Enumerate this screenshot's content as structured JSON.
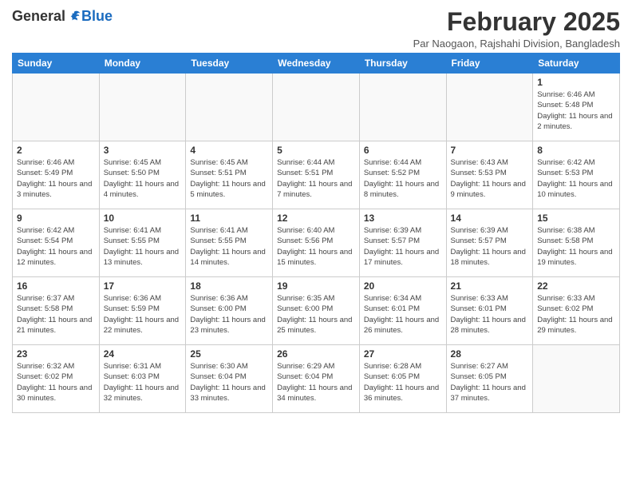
{
  "header": {
    "logo_general": "General",
    "logo_blue": "Blue",
    "month_title": "February 2025",
    "subtitle": "Par Naogaon, Rajshahi Division, Bangladesh"
  },
  "weekdays": [
    "Sunday",
    "Monday",
    "Tuesday",
    "Wednesday",
    "Thursday",
    "Friday",
    "Saturday"
  ],
  "weeks": [
    [
      {
        "day": "",
        "info": ""
      },
      {
        "day": "",
        "info": ""
      },
      {
        "day": "",
        "info": ""
      },
      {
        "day": "",
        "info": ""
      },
      {
        "day": "",
        "info": ""
      },
      {
        "day": "",
        "info": ""
      },
      {
        "day": "1",
        "info": "Sunrise: 6:46 AM\nSunset: 5:48 PM\nDaylight: 11 hours and 2 minutes."
      }
    ],
    [
      {
        "day": "2",
        "info": "Sunrise: 6:46 AM\nSunset: 5:49 PM\nDaylight: 11 hours and 3 minutes."
      },
      {
        "day": "3",
        "info": "Sunrise: 6:45 AM\nSunset: 5:50 PM\nDaylight: 11 hours and 4 minutes."
      },
      {
        "day": "4",
        "info": "Sunrise: 6:45 AM\nSunset: 5:51 PM\nDaylight: 11 hours and 5 minutes."
      },
      {
        "day": "5",
        "info": "Sunrise: 6:44 AM\nSunset: 5:51 PM\nDaylight: 11 hours and 7 minutes."
      },
      {
        "day": "6",
        "info": "Sunrise: 6:44 AM\nSunset: 5:52 PM\nDaylight: 11 hours and 8 minutes."
      },
      {
        "day": "7",
        "info": "Sunrise: 6:43 AM\nSunset: 5:53 PM\nDaylight: 11 hours and 9 minutes."
      },
      {
        "day": "8",
        "info": "Sunrise: 6:42 AM\nSunset: 5:53 PM\nDaylight: 11 hours and 10 minutes."
      }
    ],
    [
      {
        "day": "9",
        "info": "Sunrise: 6:42 AM\nSunset: 5:54 PM\nDaylight: 11 hours and 12 minutes."
      },
      {
        "day": "10",
        "info": "Sunrise: 6:41 AM\nSunset: 5:55 PM\nDaylight: 11 hours and 13 minutes."
      },
      {
        "day": "11",
        "info": "Sunrise: 6:41 AM\nSunset: 5:55 PM\nDaylight: 11 hours and 14 minutes."
      },
      {
        "day": "12",
        "info": "Sunrise: 6:40 AM\nSunset: 5:56 PM\nDaylight: 11 hours and 15 minutes."
      },
      {
        "day": "13",
        "info": "Sunrise: 6:39 AM\nSunset: 5:57 PM\nDaylight: 11 hours and 17 minutes."
      },
      {
        "day": "14",
        "info": "Sunrise: 6:39 AM\nSunset: 5:57 PM\nDaylight: 11 hours and 18 minutes."
      },
      {
        "day": "15",
        "info": "Sunrise: 6:38 AM\nSunset: 5:58 PM\nDaylight: 11 hours and 19 minutes."
      }
    ],
    [
      {
        "day": "16",
        "info": "Sunrise: 6:37 AM\nSunset: 5:58 PM\nDaylight: 11 hours and 21 minutes."
      },
      {
        "day": "17",
        "info": "Sunrise: 6:36 AM\nSunset: 5:59 PM\nDaylight: 11 hours and 22 minutes."
      },
      {
        "day": "18",
        "info": "Sunrise: 6:36 AM\nSunset: 6:00 PM\nDaylight: 11 hours and 23 minutes."
      },
      {
        "day": "19",
        "info": "Sunrise: 6:35 AM\nSunset: 6:00 PM\nDaylight: 11 hours and 25 minutes."
      },
      {
        "day": "20",
        "info": "Sunrise: 6:34 AM\nSunset: 6:01 PM\nDaylight: 11 hours and 26 minutes."
      },
      {
        "day": "21",
        "info": "Sunrise: 6:33 AM\nSunset: 6:01 PM\nDaylight: 11 hours and 28 minutes."
      },
      {
        "day": "22",
        "info": "Sunrise: 6:33 AM\nSunset: 6:02 PM\nDaylight: 11 hours and 29 minutes."
      }
    ],
    [
      {
        "day": "23",
        "info": "Sunrise: 6:32 AM\nSunset: 6:02 PM\nDaylight: 11 hours and 30 minutes."
      },
      {
        "day": "24",
        "info": "Sunrise: 6:31 AM\nSunset: 6:03 PM\nDaylight: 11 hours and 32 minutes."
      },
      {
        "day": "25",
        "info": "Sunrise: 6:30 AM\nSunset: 6:04 PM\nDaylight: 11 hours and 33 minutes."
      },
      {
        "day": "26",
        "info": "Sunrise: 6:29 AM\nSunset: 6:04 PM\nDaylight: 11 hours and 34 minutes."
      },
      {
        "day": "27",
        "info": "Sunrise: 6:28 AM\nSunset: 6:05 PM\nDaylight: 11 hours and 36 minutes."
      },
      {
        "day": "28",
        "info": "Sunrise: 6:27 AM\nSunset: 6:05 PM\nDaylight: 11 hours and 37 minutes."
      },
      {
        "day": "",
        "info": ""
      }
    ]
  ]
}
